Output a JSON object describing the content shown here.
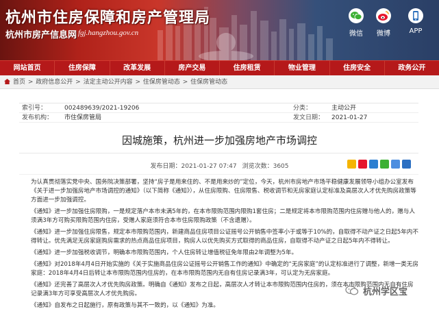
{
  "header": {
    "title": "杭州市住房保障和房产管理局",
    "subtitle": "杭州市房产信息网",
    "url": "fgj.hangzhou.gov.cn",
    "social": [
      {
        "icon": "wechat-icon",
        "label": "微信"
      },
      {
        "icon": "weibo-icon",
        "label": "微博"
      },
      {
        "icon": "app-icon",
        "label": "APP"
      }
    ]
  },
  "nav": {
    "items": [
      "网站首页",
      "住房保障",
      "改革发展",
      "房产交易",
      "住房租赁",
      "物业管理",
      "住房安全",
      "政务公开"
    ]
  },
  "breadcrumb": {
    "items": [
      "首页",
      "政府信息公开",
      "法定主动公开内容",
      "住保房管动态",
      "住保房管动态"
    ]
  },
  "meta": {
    "index_label": "索引号：",
    "index_value": "002489639/2021-19206",
    "category_label": "分类：",
    "category_value": "主动公开",
    "org_label": "发布机构：",
    "org_value": "市住保房管局",
    "date_label": "发文日期：",
    "date_value": "2021-01-27"
  },
  "article": {
    "title": "因城施策，杭州进一步加强房地产市场调控",
    "publish_label": "发布日期：",
    "publish_value": "2021-01-27 07:47",
    "views_label": "浏览次数：",
    "views_value": "3605",
    "paragraphs": [
      "为认真贯彻落实党中央、国务院决策部署，坚持“房子是用来住的、不是用来炒的”定位，今天，杭州市房地产市场平稳健康发展领导小组办公室发布《关于进一步加强房地产市场调控的通知》（以下简称《通知》），从住房限购、住房限售、税收调节和无房家庭认定标准及高层次人才优先购房政策等方面进一步加强调控。",
      "《通知》进一步加强住房限购，一是规定落户本市未满5年的，在本市限购范围内限购1套住房；二是规定将本市限购范围内住房赠与他人的，赠与人须满3年方可购买限购范围内住房，受赠人家庭须符合本市住房限购政策（不含遗赠）。",
      "《通知》进一步加强住房限售，规定本市限购范围内，新建商品住房项目公证摇号公开销售中签率小于或等于10%的，自取得不动产证之日起5年内不得转让。优先满足无房家庭购房需求的热点商品住房项目，购房人以优先购买方式取得的商品住房，自取得不动产证之日起5年内不得转让。",
      "《通知》进一步加强税收调节，明确本市限购范围内，个人住房转让增值税征免年限由2年调整为5年。",
      "《通知》对2018年4月4日开始实施的《关于实施商品住房公证摇号公开销售工作的通知》中确定的“无房家庭”的认定标准进行了调整，新增一类无房家庭：2018年4月4日后转让本市限购范围内住房的，在本市限购范围内无自有住房记录满3年，可认定为无房家庭。",
      "《通知》还完善了高层次人才优先购房政策。明确自《通知》发布之日起，高层次人才转让本市限购范围内住房的，须在本市限购范围内无自有住房记录满3年方可享受高层次人才优先购房。",
      "《通知》自发布之日起施行，原有政策与其不一致的，以《通知》为准。"
    ]
  },
  "watermark": {
    "text": "杭州学区宝"
  },
  "colors": {
    "nav": "#b5191a",
    "header_left": "#b0221a",
    "header_right": "#2a3f66"
  }
}
